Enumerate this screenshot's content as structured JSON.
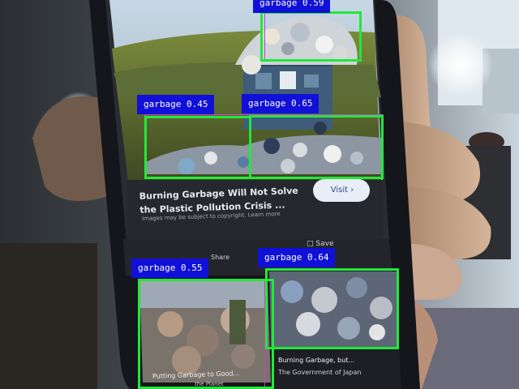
{
  "scene": {
    "colors": {
      "detection_box": "#22e83a",
      "detection_label_bg": "#1010d8",
      "inner_box": "#d63ad0"
    }
  },
  "phone_ui": {
    "result_title": "Burning Garbage Will Not Solve the Plastic Pollution Crisis ...",
    "copyright_note": "Images may be subject to copyright. Learn more",
    "visit_button": "Visit",
    "share_label": "Share",
    "save_label": "Save",
    "card_left_title": "Putting Garbage to Good...",
    "card_left_subtitle": "the Planet",
    "card_right_title": "Burning Garbage, but...",
    "card_right_subtitle": "The Government of Japan"
  },
  "detections": [
    {
      "label": "garbage 0.59"
    },
    {
      "label": "garbage 0.45"
    },
    {
      "label": "garbage 0.65"
    },
    {
      "label": "garbage 0.55"
    },
    {
      "label": "garbage 0.64"
    }
  ]
}
